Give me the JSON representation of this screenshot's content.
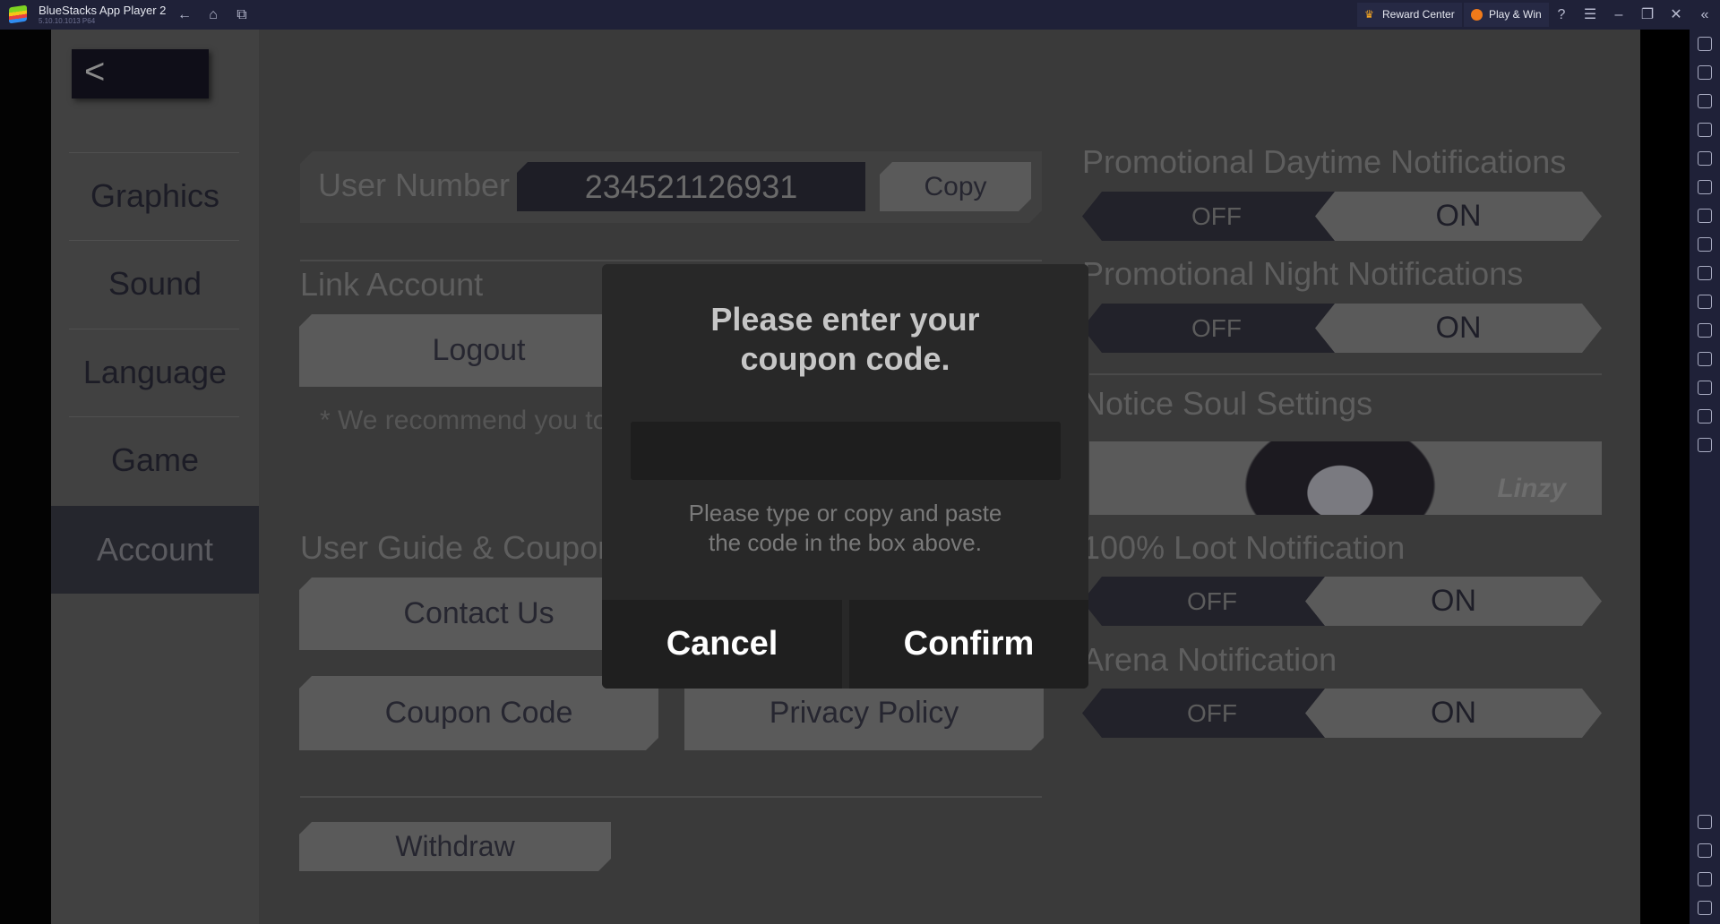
{
  "titlebar": {
    "app_name": "BlueStacks App Player 2",
    "version": "5.10.10.1013  P64",
    "reward_center": "Reward Center",
    "play_win": "Play & Win"
  },
  "sidebar": {
    "items": [
      {
        "label": "Graphics"
      },
      {
        "label": "Sound"
      },
      {
        "label": "Language"
      },
      {
        "label": "Game"
      },
      {
        "label": "Account",
        "active": true
      }
    ]
  },
  "account": {
    "user_number_label": "User Number",
    "user_number": "234521126931",
    "copy": "Copy",
    "link_account": "Link Account",
    "logout": "Logout",
    "note": "* We recommend you to",
    "guide_title": "User Guide & Coupons",
    "contact_us": "Contact Us",
    "coupon_code": "Coupon Code",
    "privacy_policy": "Privacy Policy",
    "withdraw": "Withdraw"
  },
  "notifications": {
    "daytime": {
      "title": "Promotional Daytime Notifications",
      "off": "OFF",
      "on": "ON",
      "value": "ON"
    },
    "night": {
      "title": "Promotional Night Notifications",
      "off": "OFF",
      "on": "ON",
      "value": "ON"
    },
    "soul_title": "Notice Soul Settings",
    "soul_name": "Linzy",
    "loot": {
      "title": "100% Loot Notification",
      "off": "OFF",
      "on": "ON",
      "value": "ON"
    },
    "arena": {
      "title": "Arena Notification",
      "off": "OFF",
      "on": "ON",
      "value": "ON"
    }
  },
  "dialog": {
    "title": "Please enter your coupon code.",
    "input_value": "",
    "help": "Please type or copy and paste the code in the box above.",
    "cancel": "Cancel",
    "confirm": "Confirm"
  },
  "right_toolbar_icons": [
    "fullscreen-icon",
    "volume-icon",
    "media-icon",
    "keyboard-icon",
    "rotate-icon",
    "sync-icon",
    "macro-icon",
    "screenshot-capture-icon",
    "screenshot-icon",
    "folder-icon",
    "multi-instance-icon",
    "eco-mode-icon",
    "location-icon",
    "layers-icon",
    "performance-icon"
  ],
  "right_toolbar_bottom_icons": [
    "settings-icon",
    "back-icon",
    "home-icon",
    "recent-apps-icon"
  ]
}
